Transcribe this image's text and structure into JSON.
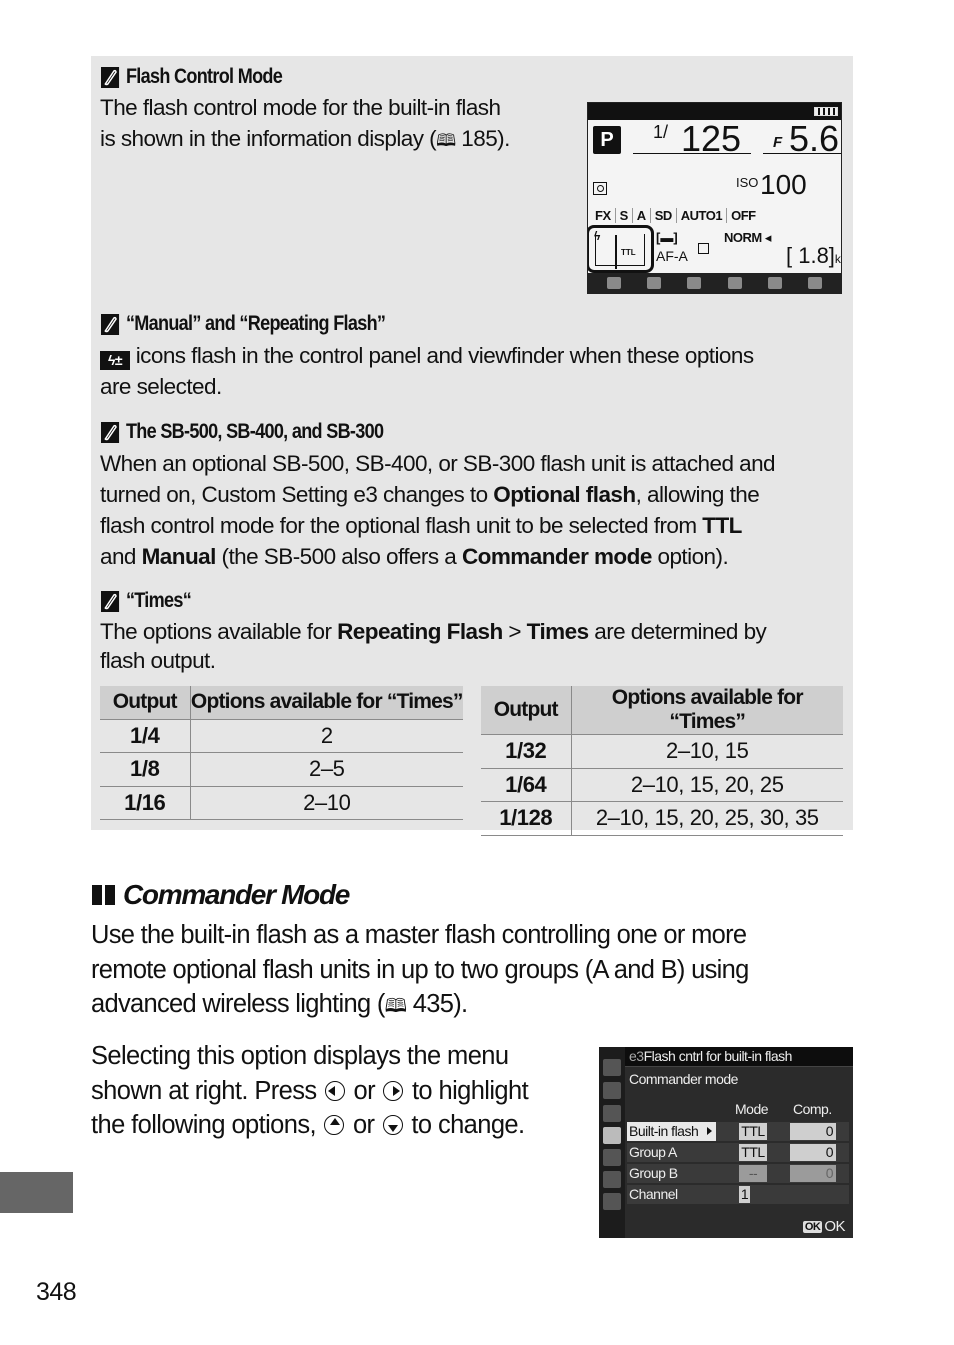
{
  "notes": {
    "flash_control": {
      "title": "Flash Control Mode",
      "body_line1": "The flash control mode for the built-in flash",
      "body_line2_pre": "is shown in the information display (",
      "page_ref": "185",
      "body_line2_post": ")."
    },
    "manual_repeating": {
      "title": "“Manual” and “Repeating Flash”",
      "body_line1": " icons flash in the control panel and viewfinder when these options",
      "body_line2": "are selected."
    },
    "sb_units": {
      "title": "The SB-500, SB-400, and SB-300",
      "line1": "When an optional SB-500, SB-400, or SB-300 flash unit is attached and",
      "line2_pre": "turned on, Custom Setting e3 changes to ",
      "line2_bold": "Optional flash",
      "line2_post": ", allowing the",
      "line3_pre": "flash control mode for the optional flash unit to be selected from ",
      "line3_bold": "TTL",
      "line4_pre": "and ",
      "line4_bold1": "Manual",
      "line4_mid": " (the SB-500 also offers a ",
      "line4_bold2": "Commander mode",
      "line4_post": " option)."
    },
    "times": {
      "title": "“Times“",
      "line1_pre": "The options available for ",
      "line1_bold1": "Repeating Flash",
      "line1_sep": " > ",
      "line1_bold2": "Times",
      "line1_post": " are determined by",
      "line2": "flash output."
    }
  },
  "info_display": {
    "mode": "P",
    "shutter_prefix": "1/",
    "shutter": "125",
    "aperture_prefix": "F",
    "aperture": "5.6",
    "iso_label": "ISO",
    "iso": "100",
    "row3": [
      "FX",
      "S",
      "A",
      "SD",
      "AUTO1",
      "OFF"
    ],
    "flash_mode": "TTL",
    "focus_area": "[▬]",
    "af_mode": "AF-A",
    "image_quality": "NORM",
    "remaining": "[ 1.8]",
    "remaining_unit": "k"
  },
  "tables": {
    "headers": [
      "Output",
      "Options available for “Times”"
    ],
    "left": [
      [
        "1/4",
        "2"
      ],
      [
        "1/8",
        "2–5"
      ],
      [
        "1/16",
        "2–10"
      ]
    ],
    "right": [
      [
        "1/32",
        "2–10, 15"
      ],
      [
        "1/64",
        "2–10, 15, 20, 25"
      ],
      [
        "1/128",
        "2–10, 15, 20, 25, 30, 35"
      ]
    ]
  },
  "commander": {
    "heading": "Commander Mode",
    "para1_line1": "Use the built-in flash as a master flash controlling one or more",
    "para1_line2": "remote optional flash units in up to two groups (A and B) using",
    "para1_line3_pre": "advanced wireless lighting (",
    "para1_page_ref": "435",
    "para1_line3_post": ").",
    "para2_line1": "Selecting this option displays the menu",
    "para2_line2_pre": "shown at right.  Press ",
    "para2_or": " or ",
    "para2_line2_post": " to highlight",
    "para2_line3_pre": "the following options, ",
    "para2_line3_post": " to change."
  },
  "menu": {
    "code": "e3",
    "title": "Flash cntrl for built-in flash",
    "subtitle": "Commander mode",
    "col_mode": "Mode",
    "col_comp": "Comp.",
    "rows": [
      {
        "label": "Built-in flash",
        "mode": "TTL",
        "comp": "0"
      },
      {
        "label": "Group A",
        "mode": "TTL",
        "comp": "0"
      },
      {
        "label": "Group B",
        "mode": "--",
        "comp": "0"
      },
      {
        "label": "Channel",
        "value": "1"
      }
    ],
    "ok_badge": "OK",
    "ok_label": "OK"
  },
  "page_number": "348"
}
